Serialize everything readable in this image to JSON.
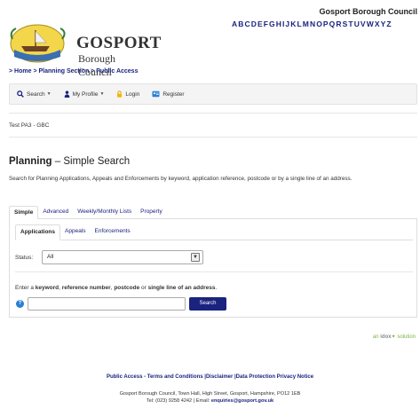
{
  "header": {
    "council_name": "Gosport Borough Council",
    "alphabet": "ABCDEFGHIJKLMNOPQRSTUVWXYZ",
    "logo_line1": "GOSPORT",
    "logo_line2": "Borough Council"
  },
  "breadcrumb": {
    "home": "> Home",
    "planning": "> Planning Section",
    "public_access": "> Public Access"
  },
  "navbar": {
    "search": "Search",
    "my_profile": "My Profile",
    "login": "Login",
    "register": "Register"
  },
  "site_code": "Test PA3 - GBC",
  "page": {
    "title_bold": "Planning",
    "title_rest": " – Simple Search",
    "description": "Search for Planning Applications, Appeals and Enforcements by keyword, application reference, postcode or by a single line of an address."
  },
  "tabs": [
    "Simple",
    "Advanced",
    "Weekly/Monthly Lists",
    "Property"
  ],
  "subtabs": [
    "Applications",
    "Appeals",
    "Enforcements"
  ],
  "status": {
    "label": "Status:",
    "value": "All"
  },
  "search": {
    "prompt_pre": "Enter a ",
    "prompt_keyword": "keyword",
    "prompt_sep1": ", ",
    "prompt_ref": "reference number",
    "prompt_sep2": ", ",
    "prompt_postcode": "postcode",
    "prompt_or": " or ",
    "prompt_line": "single line of an address",
    "prompt_end": ".",
    "button_label": "Search",
    "input_value": ""
  },
  "idox": {
    "an": "an",
    "brand": "idox",
    "solution": "solution"
  },
  "footer": {
    "links": "Public Access - Terms and Conditions |Disclaimer |Data Protection Privacy Notice",
    "address": "Gosport Borough Council, Town Hall, High Street, Gosport, Hampshire, PO12 1EB",
    "tel_pre": "Tel: (023) 9258 4242 | Email: ",
    "email": "enquiries@gosport.gov.uk"
  },
  "colors": {
    "brand_navy": "#1a237e",
    "help_blue": "#2a7fd4",
    "idox_green": "#7cb342"
  },
  "icons": [
    "search-icon",
    "user-icon",
    "lock-icon",
    "register-icon",
    "help-icon",
    "select-arrow-icon",
    "crest-logo"
  ]
}
